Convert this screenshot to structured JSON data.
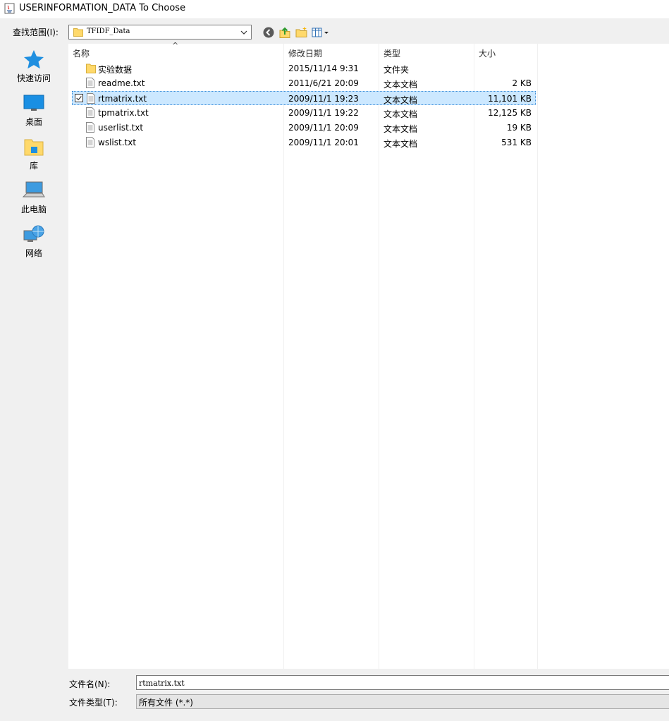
{
  "window": {
    "title": "USERINFORMATION_DATA To Choose"
  },
  "lookin": {
    "label": "查找范围(I):",
    "value": "TFIDF_Data"
  },
  "places": [
    {
      "label": "快速访问",
      "icon": "quick-access-star-icon"
    },
    {
      "label": "桌面",
      "icon": "desktop-icon"
    },
    {
      "label": "库",
      "icon": "library-icon"
    },
    {
      "label": "此电脑",
      "icon": "this-pc-icon"
    },
    {
      "label": "网络",
      "icon": "network-icon"
    }
  ],
  "columns": {
    "name": "名称",
    "modified": "修改日期",
    "type": "类型",
    "size": "大小"
  },
  "files": [
    {
      "name": "实验数据",
      "modified": "2015/11/14 9:31",
      "type": "文件夹",
      "size": "",
      "kind": "folder"
    },
    {
      "name": "readme.txt",
      "modified": "2011/6/21 20:09",
      "type": "文本文档",
      "size": "2 KB",
      "kind": "file"
    },
    {
      "name": "rtmatrix.txt",
      "modified": "2009/11/1 19:23",
      "type": "文本文档",
      "size": "11,101 KB",
      "kind": "file",
      "selected": true
    },
    {
      "name": "tpmatrix.txt",
      "modified": "2009/11/1 19:22",
      "type": "文本文档",
      "size": "12,125 KB",
      "kind": "file"
    },
    {
      "name": "userlist.txt",
      "modified": "2009/11/1 20:09",
      "type": "文本文档",
      "size": "19 KB",
      "kind": "file"
    },
    {
      "name": "wslist.txt",
      "modified": "2009/11/1 20:01",
      "type": "文本文档",
      "size": "531 KB",
      "kind": "file"
    }
  ],
  "filename": {
    "label": "文件名(N):",
    "value": "rtmatrix.txt"
  },
  "filetype": {
    "label": "文件类型(T):",
    "value": "所有文件 (*.*)"
  },
  "colors": {
    "selection": "#cce8ff",
    "folder": "#ffd96b",
    "accent": "#1e90d6"
  }
}
